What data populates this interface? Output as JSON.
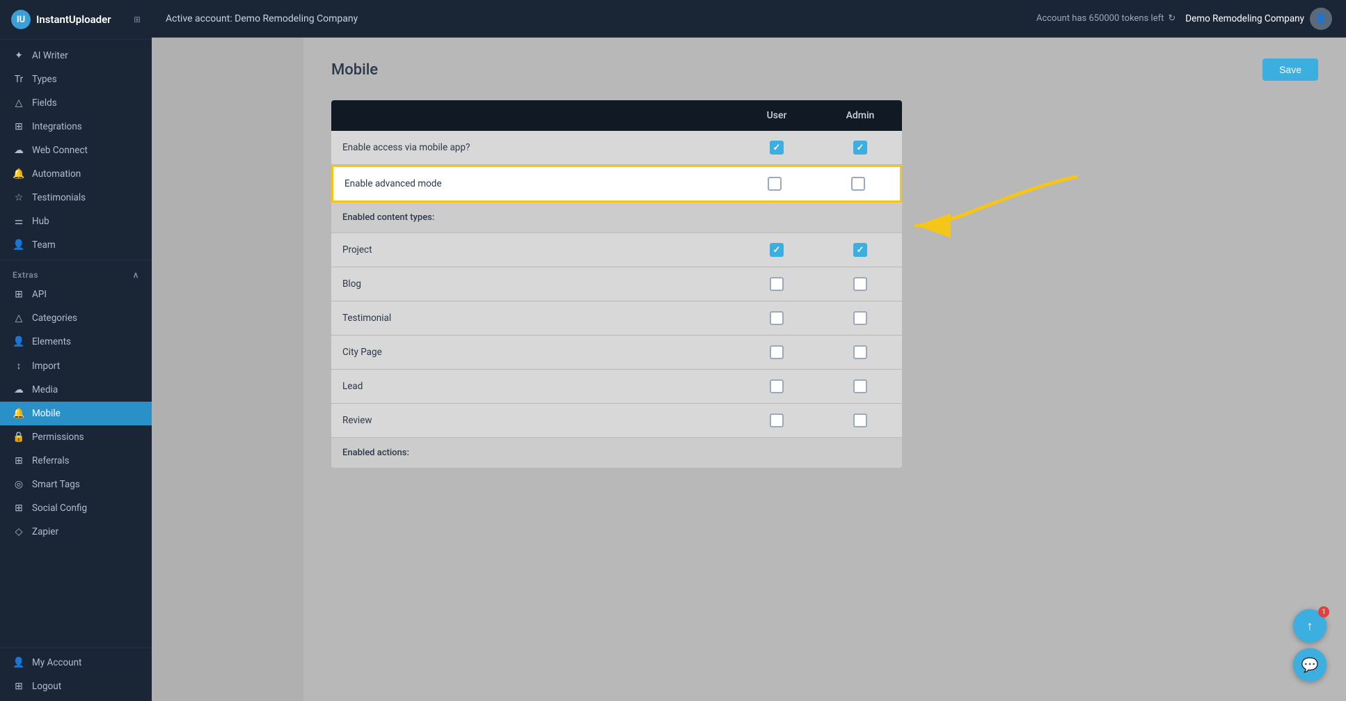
{
  "app": {
    "name": "InstantUploader",
    "logo_char": "IU"
  },
  "topbar": {
    "active_account_label": "Active account: Demo Remodeling Company",
    "tokens_label": "Account has 650000 tokens left",
    "account_name": "Demo Remodeling Company"
  },
  "sidebar": {
    "items": [
      {
        "id": "ai-writer",
        "label": "AI Writer",
        "icon": "✦"
      },
      {
        "id": "types",
        "label": "Types",
        "icon": "T"
      },
      {
        "id": "fields",
        "label": "Fields",
        "icon": "⊞"
      },
      {
        "id": "integrations",
        "label": "Integrations",
        "icon": "⊞"
      },
      {
        "id": "web-connect",
        "label": "Web Connect",
        "icon": "△"
      },
      {
        "id": "automation",
        "label": "Automation",
        "icon": "🔔"
      },
      {
        "id": "testimonials",
        "label": "Testimonials",
        "icon": "☆"
      },
      {
        "id": "hub",
        "label": "Hub",
        "icon": "⚌"
      },
      {
        "id": "team",
        "label": "Team",
        "icon": "👤"
      }
    ],
    "extras_section": "Extras",
    "extras_items": [
      {
        "id": "api",
        "label": "API",
        "icon": "⊞"
      },
      {
        "id": "categories",
        "label": "Categories",
        "icon": "△"
      },
      {
        "id": "elements",
        "label": "Elements",
        "icon": "👤"
      },
      {
        "id": "import",
        "label": "Import",
        "icon": "↕"
      },
      {
        "id": "media",
        "label": "Media",
        "icon": "☁"
      },
      {
        "id": "mobile",
        "label": "Mobile",
        "icon": "🔔"
      },
      {
        "id": "permissions",
        "label": "Permissions",
        "icon": "🔒"
      },
      {
        "id": "referrals",
        "label": "Referrals",
        "icon": "⊞"
      },
      {
        "id": "smart-tags",
        "label": "Smart Tags",
        "icon": "◎"
      },
      {
        "id": "social-config",
        "label": "Social Config",
        "icon": "⊞"
      },
      {
        "id": "zapier",
        "label": "Zapier",
        "icon": "◇"
      }
    ],
    "bottom_items": [
      {
        "id": "my-account",
        "label": "My Account",
        "icon": "👤"
      },
      {
        "id": "logout",
        "label": "Logout",
        "icon": "⊞"
      }
    ]
  },
  "page": {
    "title": "Mobile",
    "save_button": "Save"
  },
  "table": {
    "columns": [
      "",
      "User",
      "Admin"
    ],
    "rows": [
      {
        "id": "enable-access",
        "label": "Enable access via mobile app?",
        "user_checked": true,
        "admin_checked": true,
        "highlighted": false,
        "is_section": false
      },
      {
        "id": "enable-advanced",
        "label": "Enable advanced mode",
        "user_checked": false,
        "admin_checked": false,
        "highlighted": true,
        "is_section": false
      },
      {
        "id": "content-types-header",
        "label": "Enabled content types:",
        "user_checked": null,
        "admin_checked": null,
        "highlighted": false,
        "is_section": true
      },
      {
        "id": "project",
        "label": "Project",
        "user_checked": true,
        "admin_checked": true,
        "highlighted": false,
        "is_section": false
      },
      {
        "id": "blog",
        "label": "Blog",
        "user_checked": false,
        "admin_checked": false,
        "highlighted": false,
        "is_section": false
      },
      {
        "id": "testimonial",
        "label": "Testimonial",
        "user_checked": false,
        "admin_checked": false,
        "highlighted": false,
        "is_section": false
      },
      {
        "id": "city-page",
        "label": "City Page",
        "user_checked": false,
        "admin_checked": false,
        "highlighted": false,
        "is_section": false
      },
      {
        "id": "lead",
        "label": "Lead",
        "user_checked": false,
        "admin_checked": false,
        "highlighted": false,
        "is_section": false
      },
      {
        "id": "review",
        "label": "Review",
        "user_checked": false,
        "admin_checked": false,
        "highlighted": false,
        "is_section": false
      },
      {
        "id": "enabled-actions",
        "label": "Enabled actions:",
        "user_checked": null,
        "admin_checked": null,
        "highlighted": false,
        "is_section": true
      }
    ]
  },
  "chat": {
    "icon": "💬",
    "badge": "1"
  },
  "colors": {
    "accent": "#3daee0",
    "highlight_border": "#f5c518",
    "arrow_color": "#f5c518"
  }
}
